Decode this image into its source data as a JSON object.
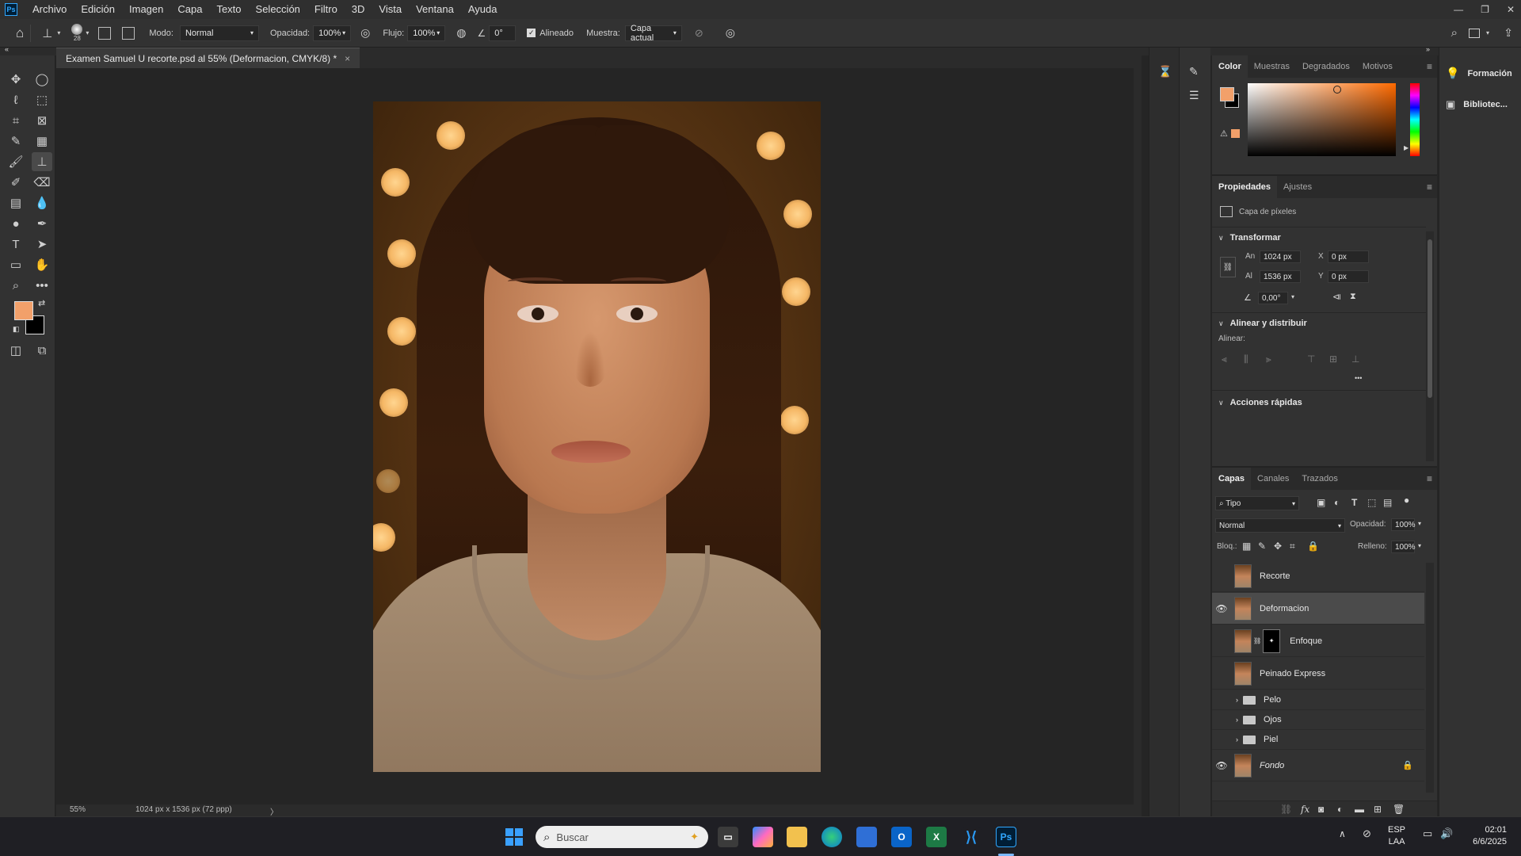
{
  "menubar": {
    "logo": "Ps",
    "items": [
      "Archivo",
      "Edición",
      "Imagen",
      "Capa",
      "Texto",
      "Selección",
      "Filtro",
      "3D",
      "Vista",
      "Ventana",
      "Ayuda"
    ]
  },
  "options": {
    "brush_size": "28",
    "mode_label": "Modo:",
    "mode_value": "Normal",
    "opacity_label": "Opacidad:",
    "opacity_value": "100%",
    "flow_label": "Flujo:",
    "flow_value": "100%",
    "angle_value": "0°",
    "aligned_label": "Alineado",
    "sample_label": "Muestra:",
    "sample_value": "Capa actual"
  },
  "document": {
    "tab_title": "Examen Samuel U recorte.psd al 55% (Deformacion, CMYK/8) *",
    "close": "×",
    "zoom": "55%",
    "info": "1024 px x 1536 px (72 ppp)",
    "info_arrow": "〉"
  },
  "color_panel": {
    "tabs": [
      "Color",
      "Muestras",
      "Degradados",
      "Motivos"
    ],
    "fg_color": "#f2a06a",
    "bg_color": "#000000"
  },
  "properties_panel": {
    "tabs": [
      "Propiedades",
      "Ajustes"
    ],
    "layer_kind": "Capa de píxeles",
    "transform_title": "Transformar",
    "an_label": "An",
    "an_value": "1024 px",
    "al_label": "Al",
    "al_value": "1536 px",
    "x_label": "X",
    "x_value": "0 px",
    "y_label": "Y",
    "y_value": "0 px",
    "angle_value": "0,00°",
    "align_title": "Alinear y distribuir",
    "align_sub": "Alinear:",
    "more": "•••",
    "quick_title": "Acciones rápidas"
  },
  "layers_panel": {
    "tabs": [
      "Capas",
      "Canales",
      "Trazados"
    ],
    "filter_value": "Tipo",
    "blend_value": "Normal",
    "opacity_label": "Opacidad:",
    "opacity_value": "100%",
    "lock_label": "Bloq.:",
    "fill_label": "Relleno:",
    "fill_value": "100%",
    "layers": [
      {
        "name": "Recorte",
        "visible": false
      },
      {
        "name": "Deformacion",
        "visible": true,
        "selected": true
      },
      {
        "name": "Enfoque",
        "visible": false,
        "mask": true
      },
      {
        "name": "Peinado Express",
        "visible": false
      },
      {
        "name": "Pelo",
        "visible": false,
        "group": true
      },
      {
        "name": "Ojos",
        "visible": false,
        "group": true
      },
      {
        "name": "Piel",
        "visible": false,
        "group": true
      },
      {
        "name": "Fondo",
        "visible": true,
        "locked": true
      }
    ]
  },
  "right_dock": {
    "items": [
      "Formación",
      "Bibliotec..."
    ]
  },
  "taskbar": {
    "search_placeholder": "Buscar",
    "lang_top": "ESP",
    "lang_bottom": "LAA",
    "time": "02:01",
    "date": "6/6/2025",
    "ps_label": "Ps",
    "xl_label": "X"
  }
}
